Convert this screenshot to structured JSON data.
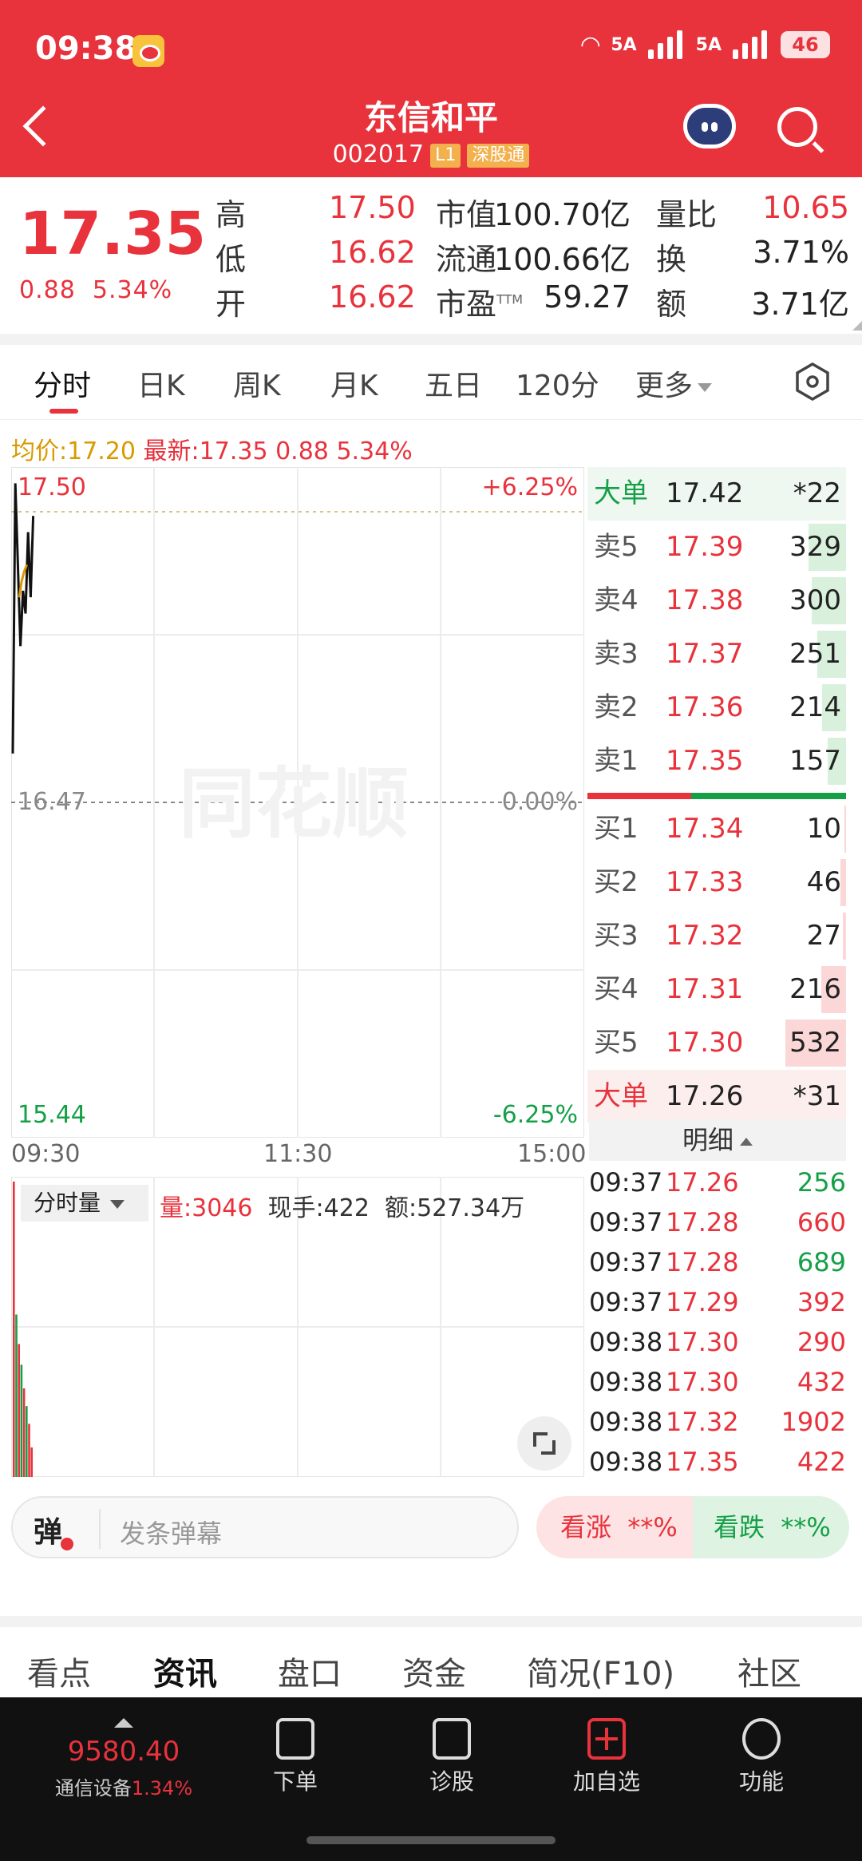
{
  "status_bar": {
    "time": "09:38",
    "network": "5A",
    "network2": "5A",
    "battery": "46"
  },
  "header": {
    "stock_name": "东信和平",
    "stock_code": "002017",
    "badge_l1": "L1",
    "badge_connect": "深股通"
  },
  "quote": {
    "price": "17.35",
    "change": "0.88",
    "change_pct": "5.34%",
    "rows": [
      {
        "l1": "高",
        "v1": "17.50",
        "l2": "市值",
        "v2": "100.70亿",
        "l3": "量比",
        "v3": "10.65"
      },
      {
        "l1": "低",
        "v1": "16.62",
        "l2": "流通",
        "v2": "100.66亿",
        "l3": "换",
        "v3": "3.71%"
      },
      {
        "l1": "开",
        "v1": "16.62",
        "l2": "市盈",
        "l2_sup": "TTM",
        "v2": "59.27",
        "l3": "额",
        "v3": "3.71亿"
      }
    ]
  },
  "period_tabs": [
    "分时",
    "日K",
    "周K",
    "月K",
    "五日",
    "120分",
    "更多"
  ],
  "avg_line": {
    "avg_label": "均价:17.20",
    "latest_label": "最新:17.35",
    "change": "0.88",
    "change_pct": "5.34%"
  },
  "chart_data": {
    "type": "line",
    "y_top": "17.50",
    "y_mid": "16.47",
    "y_bottom": "15.44",
    "pct_top": "+6.25%",
    "pct_mid": "0.00%",
    "pct_bottom": "-6.25%",
    "x_ticks": [
      "09:30",
      "11:30",
      "15:00"
    ],
    "ylim": [
      15.44,
      17.5
    ],
    "price_series": [
      16.62,
      17.45,
      17.2,
      16.95,
      17.12,
      17.05,
      17.3,
      17.1,
      17.35
    ],
    "avg_series": [
      17.1,
      17.15,
      17.18,
      17.2
    ]
  },
  "volume": {
    "selector": "分时量",
    "vol_label": "量:3046",
    "current_label": "现手:422",
    "amount_label": "额:527.34万",
    "bars": [
      {
        "v": 1.0,
        "c": "red"
      },
      {
        "v": 0.55,
        "c": "green"
      },
      {
        "v": 0.45,
        "c": "red"
      },
      {
        "v": 0.38,
        "c": "green"
      },
      {
        "v": 0.3,
        "c": "red"
      },
      {
        "v": 0.24,
        "c": "green"
      },
      {
        "v": 0.18,
        "c": "red"
      },
      {
        "v": 0.1,
        "c": "red"
      }
    ]
  },
  "orderbook": {
    "big_sell": {
      "label": "大单",
      "price": "17.42",
      "vol": "*22"
    },
    "asks": [
      {
        "label": "卖5",
        "price": "17.39",
        "vol": "329",
        "w": 0.62
      },
      {
        "label": "卖4",
        "price": "17.38",
        "vol": "300",
        "w": 0.56
      },
      {
        "label": "卖3",
        "price": "17.37",
        "vol": "251",
        "w": 0.47
      },
      {
        "label": "卖2",
        "price": "17.36",
        "vol": "214",
        "w": 0.4
      },
      {
        "label": "卖1",
        "price": "17.35",
        "vol": "157",
        "w": 0.3
      }
    ],
    "bids": [
      {
        "label": "买1",
        "price": "17.34",
        "vol": "10",
        "w": 0.02
      },
      {
        "label": "买2",
        "price": "17.33",
        "vol": "46",
        "w": 0.09
      },
      {
        "label": "买3",
        "price": "17.32",
        "vol": "27",
        "w": 0.05
      },
      {
        "label": "买4",
        "price": "17.31",
        "vol": "216",
        "w": 0.41
      },
      {
        "label": "买5",
        "price": "17.30",
        "vol": "532",
        "w": 1.0
      }
    ],
    "big_buy": {
      "label": "大单",
      "price": "17.26",
      "vol": "*31"
    }
  },
  "detail": {
    "title": "明细",
    "rows": [
      {
        "time": "09:37",
        "price": "17.26",
        "vol": "256",
        "vc": "green"
      },
      {
        "time": "09:37",
        "price": "17.28",
        "vol": "660",
        "vc": "red"
      },
      {
        "time": "09:37",
        "price": "17.28",
        "vol": "689",
        "vc": "green"
      },
      {
        "time": "09:37",
        "price": "17.29",
        "vol": "392",
        "vc": "red"
      },
      {
        "time": "09:38",
        "price": "17.30",
        "vol": "290",
        "vc": "red"
      },
      {
        "time": "09:38",
        "price": "17.30",
        "vol": "432",
        "vc": "red"
      },
      {
        "time": "09:38",
        "price": "17.32",
        "vol": "1902",
        "vc": "red"
      },
      {
        "time": "09:38",
        "price": "17.35",
        "vol": "422",
        "vc": "red"
      }
    ]
  },
  "danmaku": {
    "icon_label": "弹",
    "placeholder": "发条弹幕"
  },
  "vote": {
    "up_label": "看涨",
    "up_value": "**%",
    "down_label": "看跌",
    "down_value": "**%"
  },
  "info_tabs": [
    "看点",
    "资讯",
    "盘口",
    "资金",
    "简况(F10)",
    "社区"
  ],
  "bottom_bar": {
    "index_value": "9580.40",
    "index_name": "通信设备",
    "index_pct": "1.34%",
    "items": [
      "下单",
      "诊股",
      "加自选",
      "功能"
    ]
  },
  "colors": {
    "up": "#e8323c",
    "down": "#15a047",
    "avg": "#d99a00",
    "header": "#e8323c"
  }
}
